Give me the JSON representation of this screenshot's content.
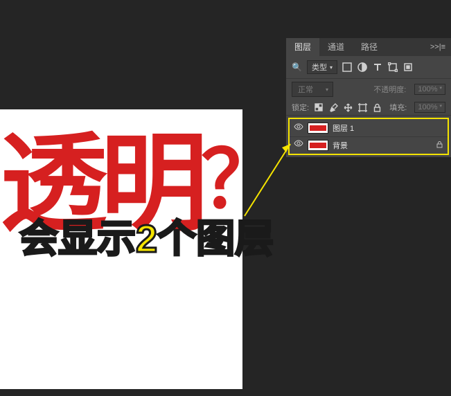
{
  "canvas": {
    "text": "透明",
    "question": "？"
  },
  "tabs": {
    "layers": "图层",
    "channels": "通道",
    "paths": "路径",
    "menu": ">>|≡"
  },
  "filter": {
    "type_label": "类型"
  },
  "blend": {
    "mode": "正常",
    "opacity_label": "不透明度:",
    "opacity_value": "100%"
  },
  "lock": {
    "label": "锁定:",
    "fill_label": "填充:",
    "fill_value": "100%"
  },
  "layers": [
    {
      "name": "图层 1",
      "locked": false
    },
    {
      "name": "背景",
      "locked": true
    }
  ],
  "annotation": "会显示2个图层"
}
